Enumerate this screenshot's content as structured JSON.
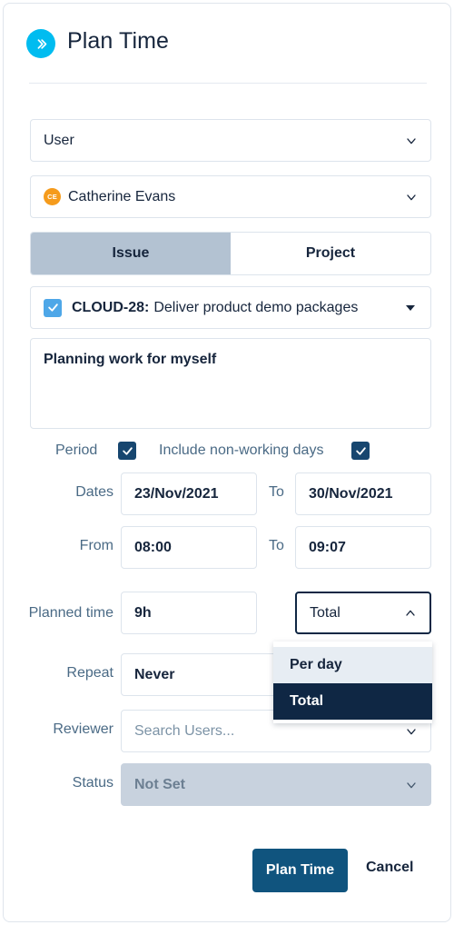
{
  "dialog": {
    "title": "Plan Time",
    "header_icon": "double-chevron-right-icon"
  },
  "selects": {
    "scope": {
      "value": "User",
      "icon": "chevron-down-icon"
    },
    "person": {
      "value": "Catherine Evans",
      "avatar_initials": "CE",
      "avatar_color": "#f59b1c",
      "icon": "chevron-down-icon"
    }
  },
  "tabs": [
    {
      "label": "Issue",
      "active": true
    },
    {
      "label": "Project",
      "active": false
    }
  ],
  "issue": {
    "checked": true,
    "key": "CLOUD-28:",
    "summary": "Deliver product demo packages",
    "caret": "caret-down-icon"
  },
  "note": {
    "value": "Planning work for myself"
  },
  "period": {
    "label": "Period",
    "checked": true,
    "include_non_working_label": "Include non-working days",
    "include_non_working_checked": true
  },
  "rows": {
    "dates": {
      "label": "Dates",
      "from": "23/Nov/2021",
      "to_label": "To",
      "to": "30/Nov/2021"
    },
    "time": {
      "label": "From",
      "from": "08:00",
      "to_label": "To",
      "to": "09:07"
    },
    "planned": {
      "label": "Planned time",
      "amount": "9h",
      "unit": "Total",
      "unit_icon": "chevron-up-icon"
    },
    "repeat": {
      "label": "Repeat",
      "value": "Never"
    },
    "reviewer": {
      "label": "Reviewer",
      "placeholder": "Search Users...",
      "icon": "chevron-down-icon"
    },
    "status": {
      "label": "Status",
      "value": "Not Set",
      "disabled": true,
      "icon": "chevron-down-icon"
    }
  },
  "dropdown": {
    "open": true,
    "options": [
      {
        "label": "Per day",
        "state": "hover"
      },
      {
        "label": "Total",
        "state": "selected"
      }
    ]
  },
  "footer": {
    "primary_label": "Plan Time",
    "cancel_label": "Cancel"
  },
  "colors": {
    "accent_cyan": "#00bcf0",
    "navy": "#0f2744",
    "primary_button": "#10547e",
    "tab_active": "#b3c2d2"
  }
}
